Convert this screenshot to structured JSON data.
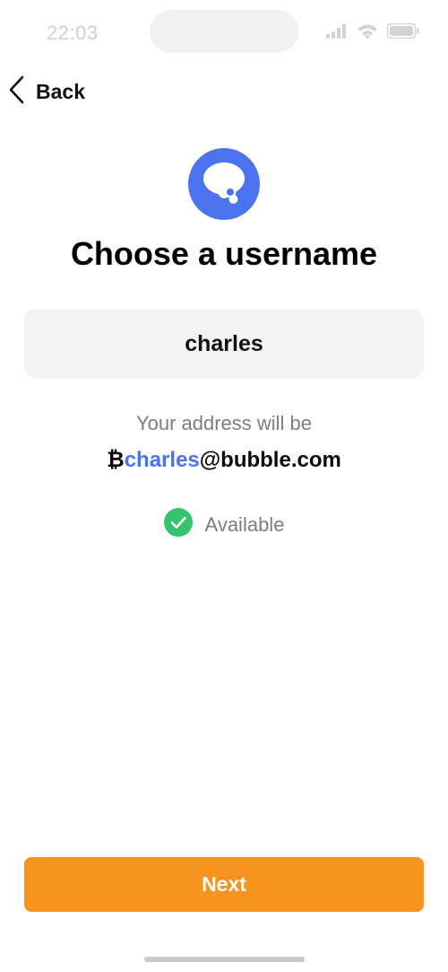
{
  "status_bar": {
    "time": "22:03",
    "icons": [
      "signal-icon",
      "wifi-icon",
      "battery-icon"
    ]
  },
  "nav": {
    "back_label": "Back",
    "back_icon": "chevron-left-icon"
  },
  "logo": {
    "icon": "thought-bubble-icon",
    "color": "#4b73f0"
  },
  "title": "Choose a username",
  "username": {
    "value": "charles"
  },
  "address": {
    "caption": "Your address will be",
    "prefix": "₿",
    "username": "charles",
    "domain": "@bubble.com"
  },
  "availability": {
    "label": "Available",
    "icon": "check-circle-icon",
    "color": "#34c46b"
  },
  "next_button": {
    "label": "Next",
    "color": "#f7941f"
  },
  "colors": {
    "accent": "#4b73f0",
    "primary_button": "#f7941f",
    "success": "#34c46b"
  }
}
